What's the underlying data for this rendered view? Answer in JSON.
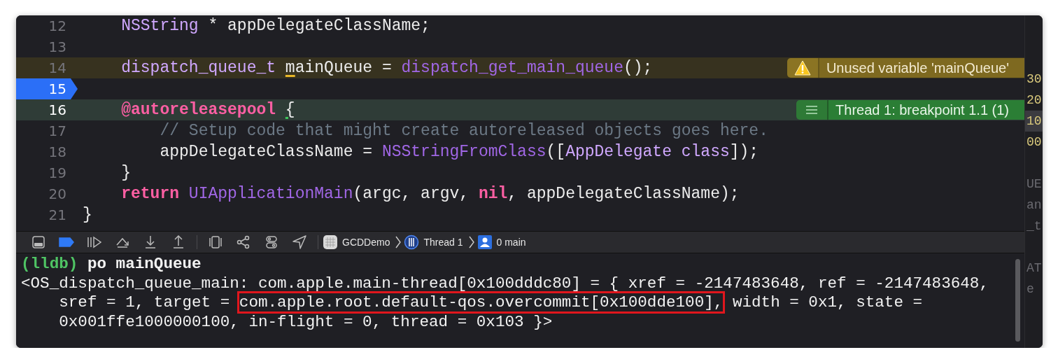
{
  "editor": {
    "lines": [
      {
        "number": "12",
        "breakpoint": false,
        "tokens": [
          {
            "kind": "type",
            "text": "    NSString"
          },
          {
            "kind": "plain",
            "text": " * appDelegateClassName;"
          }
        ]
      },
      {
        "number": "13",
        "breakpoint": false
      },
      {
        "number": "14",
        "breakpoint": false,
        "tokens": [
          {
            "kind": "type",
            "text": "    dispatch_queue_t "
          },
          {
            "kind": "flagged",
            "text": "m"
          },
          {
            "kind": "plain",
            "text": "ainQueue = "
          },
          {
            "kind": "func",
            "text": "dispatch_get_main_queue"
          },
          {
            "kind": "plain",
            "text": "();"
          }
        ],
        "annotation": {
          "kind": "warning",
          "text": "Unused variable 'mainQueue'"
        }
      },
      {
        "number": "15",
        "breakpoint": true
      },
      {
        "number": "16",
        "breakpoint": false,
        "tokens": [
          {
            "kind": "keyword",
            "text": "    @autoreleasepool "
          },
          {
            "kind": "flagged",
            "text": "{"
          }
        ],
        "annotation": {
          "kind": "debug",
          "text": "Thread 1: breakpoint 1.1 (1)"
        }
      },
      {
        "number": "17",
        "breakpoint": false,
        "tokens": [
          {
            "kind": "comment",
            "text": "        // Setup code that might create autoreleased objects goes here."
          }
        ]
      },
      {
        "number": "18",
        "breakpoint": false,
        "tokens": [
          {
            "kind": "plain",
            "text": "        appDelegateClassName = "
          },
          {
            "kind": "func",
            "text": "NSStringFromClass"
          },
          {
            "kind": "plain",
            "text": "(["
          },
          {
            "kind": "type",
            "text": "AppDelegate class"
          },
          {
            "kind": "plain",
            "text": "]);"
          }
        ]
      },
      {
        "number": "19",
        "breakpoint": false,
        "tokens": [
          {
            "kind": "plain",
            "text": "    }"
          }
        ]
      },
      {
        "number": "20",
        "breakpoint": false,
        "tokens": [
          {
            "kind": "keyword",
            "text": "    return "
          },
          {
            "kind": "func",
            "text": "UIApplicationMain"
          },
          {
            "kind": "plain",
            "text": "(argc, argv, "
          },
          {
            "kind": "keyword",
            "text": "nil"
          },
          {
            "kind": "plain",
            "text": ", appDelegateClassName);"
          }
        ]
      },
      {
        "number": "21",
        "breakpoint": false,
        "tokens": [
          {
            "kind": "plain",
            "text": "}"
          }
        ]
      }
    ]
  },
  "side_column": {
    "groups": [
      [
        {
          "kind": "number",
          "text": "30",
          "highlighted": false
        },
        {
          "kind": "number",
          "text": "20",
          "highlighted": false
        },
        {
          "kind": "number",
          "text": "10",
          "highlighted": true
        },
        {
          "kind": "number",
          "text": "00",
          "highlighted": false
        }
      ],
      [
        {
          "kind": "text",
          "text": "UE",
          "highlighted": false
        },
        {
          "kind": "text",
          "text": "an",
          "highlighted": false
        },
        {
          "kind": "text",
          "text": "_t",
          "highlighted": false
        }
      ],
      [
        {
          "kind": "text",
          "text": "AT",
          "highlighted": false
        },
        {
          "kind": "text",
          "text": "e",
          "highlighted": false
        }
      ]
    ]
  },
  "debug_bar": {
    "button_groups": [
      [
        {
          "kind": "console-toggle",
          "on": false
        },
        {
          "kind": "breakpoints",
          "on": true
        },
        {
          "kind": "continue",
          "on": false
        },
        {
          "kind": "step-over",
          "on": false
        },
        {
          "kind": "step-into",
          "on": false
        },
        {
          "kind": "step-out",
          "on": false
        }
      ],
      [
        {
          "kind": "view-debugger",
          "on": false
        },
        {
          "kind": "memory-graph",
          "on": false
        },
        {
          "kind": "environment",
          "on": false
        },
        {
          "kind": "location",
          "on": false
        }
      ]
    ],
    "breadcrumbs": [
      {
        "kind": "app",
        "label": "GCDDemo"
      },
      {
        "kind": "thread",
        "label": "Thread 1"
      },
      {
        "kind": "frame",
        "label": "0 main"
      }
    ]
  },
  "console": {
    "lines": [
      [
        {
          "kind": "prompt",
          "text": "(lldb)"
        },
        {
          "kind": "command",
          "text": " po mainQueue"
        }
      ],
      [
        {
          "kind": "output",
          "text": "<OS_dispatch_queue_main: com.apple.main-thread[0x100dddc80] = { xref = -2147483648, ref = -2147483648,"
        }
      ],
      [
        {
          "kind": "output",
          "text": "    sref = 1, target = "
        },
        {
          "kind": "boxed",
          "text": "com.apple.root.default-qos.overcommit[0x100dde100],"
        },
        {
          "kind": "output",
          "text": " width = 0x1, state ="
        }
      ],
      [
        {
          "kind": "output",
          "text": "    0x001ffe1000000100, in-flight = 0, thread = 0x103 }>"
        }
      ]
    ]
  }
}
